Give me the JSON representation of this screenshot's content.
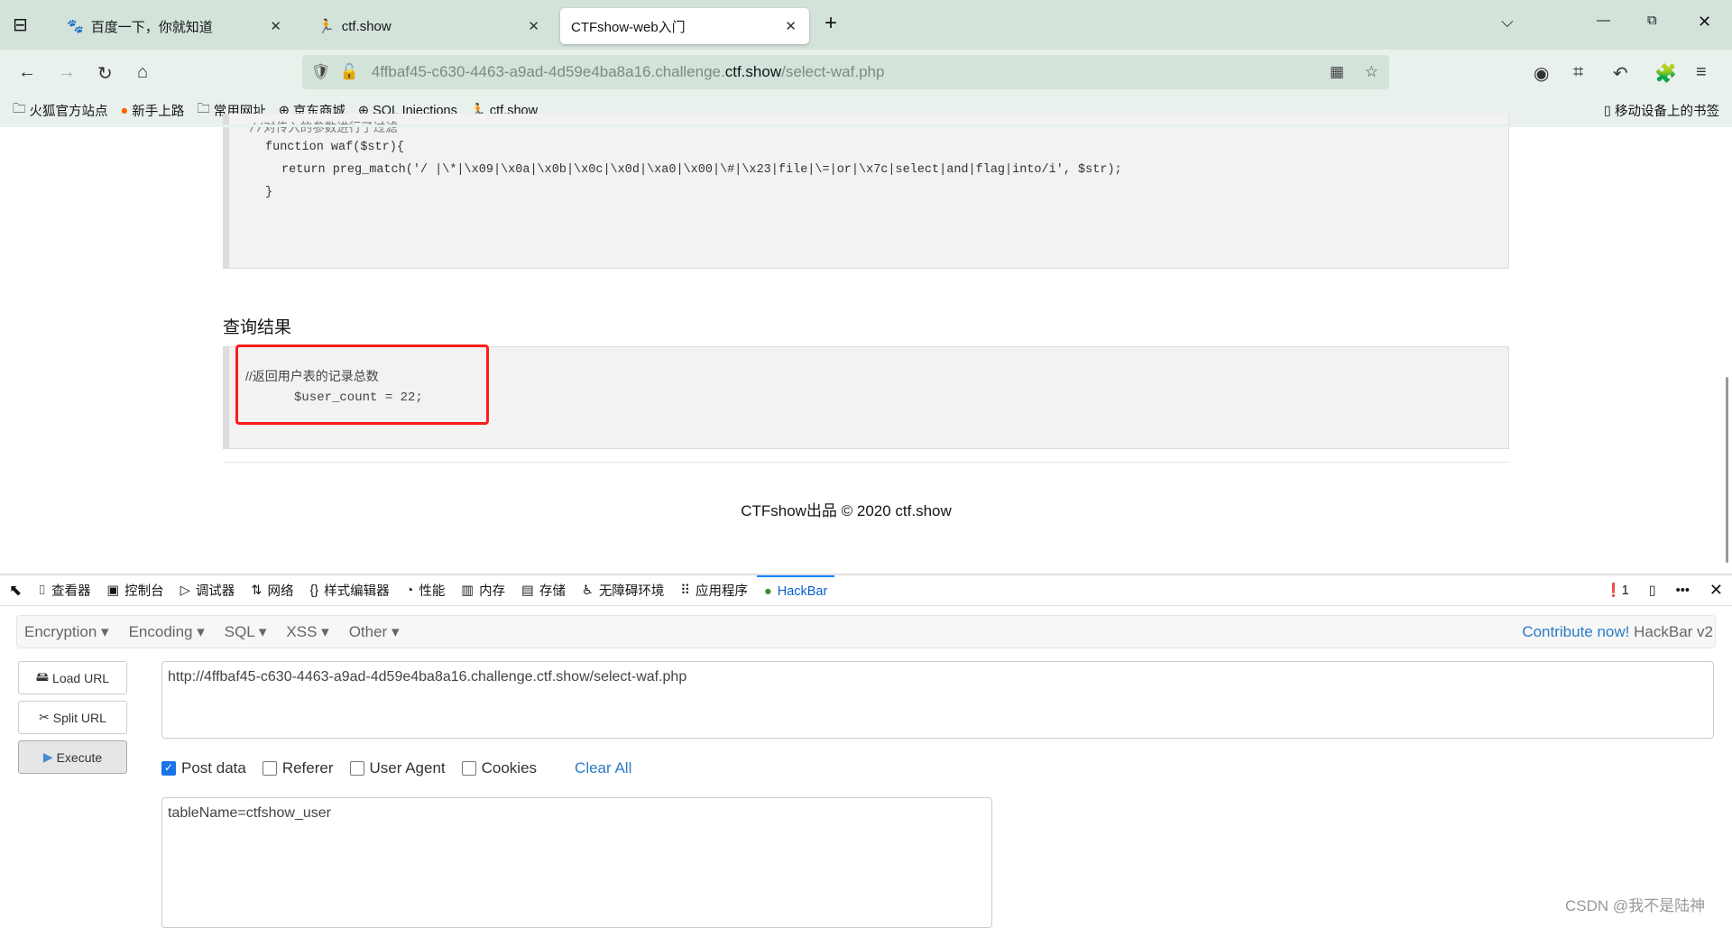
{
  "browser": {
    "tabs": [
      {
        "label": "百度一下，你就知道",
        "icon": "baidu-icon"
      },
      {
        "label": "ctf.show",
        "icon": "ctfshow-icon"
      },
      {
        "label": "CTFshow-web入门",
        "active": true
      }
    ],
    "url_prefix": "4ffbaf45-c630-4463-a9ad-4d59e4ba8a16.challenge.",
    "url_domain": "ctf.show",
    "url_path": "/select-waf.php",
    "bookmarks": [
      {
        "label": "火狐官方站点",
        "icon": "folder-icon"
      },
      {
        "label": "新手上路",
        "icon": "firefox-icon"
      },
      {
        "label": "常用网址",
        "icon": "folder-icon"
      },
      {
        "label": "京东商城",
        "icon": "globe-icon"
      },
      {
        "label": "SQL Injections",
        "icon": "globe-icon"
      },
      {
        "label": "ctf.show",
        "icon": "ctfshow-icon"
      }
    ],
    "mobile_bookmarks": "移动设备上的书签"
  },
  "page": {
    "code_lines": [
      "//对传入的参数进行了过滤",
      "function waf($str){",
      "return preg_match('/ |\\*|\\x09|\\x0a|\\x0b|\\x0c|\\x0d|\\xa0|\\x00|\\#|\\x23|file|\\=|or|\\x7c|select|and|flag|into/i', $str);",
      "}"
    ],
    "result_title": "查询结果",
    "result_comment": "//返回用户表的记录总数",
    "result_code": "$user_count = 22;",
    "footer": "CTFshow出品 © 2020 ctf.show",
    "highlight_color": "#ff1a1a"
  },
  "devtools": {
    "tabs": [
      {
        "label": "查看器"
      },
      {
        "label": "控制台"
      },
      {
        "label": "调试器"
      },
      {
        "label": "网络"
      },
      {
        "label": "样式编辑器"
      },
      {
        "label": "性能"
      },
      {
        "label": "内存"
      },
      {
        "label": "存储"
      },
      {
        "label": "无障碍环境"
      },
      {
        "label": "应用程序"
      },
      {
        "label": "HackBar",
        "active": true
      }
    ],
    "error_count": "1"
  },
  "hackbar": {
    "menus": [
      "Encryption",
      "Encoding",
      "SQL",
      "XSS",
      "Other"
    ],
    "contribute": "Contribute now!",
    "version": "HackBar v2",
    "load_url": "Load URL",
    "split_url": "Split URL",
    "execute": "Execute",
    "url_value": "http://4ffbaf45-c630-4463-a9ad-4d59e4ba8a16.challenge.ctf.show/select-waf.php",
    "options": [
      {
        "label": "Post data",
        "checked": true
      },
      {
        "label": "Referer",
        "checked": false
      },
      {
        "label": "User Agent",
        "checked": false
      },
      {
        "label": "Cookies",
        "checked": false
      }
    ],
    "clear_all": "Clear All",
    "post_value": "tableName=ctfshow_user"
  },
  "watermark": "CSDN @我不是陆神"
}
